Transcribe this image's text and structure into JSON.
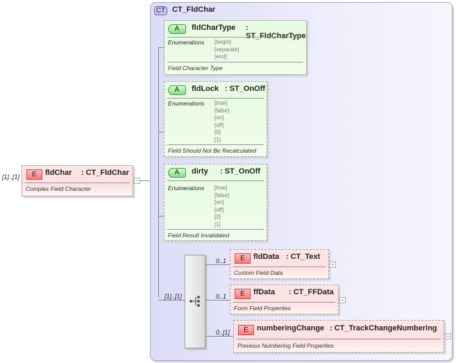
{
  "root": {
    "multiplicity": "[1]..[1]",
    "badge": "E",
    "name": "fldChar",
    "type": ": CT_FldChar",
    "description": "Complex Field Character",
    "collapse": "−"
  },
  "complex_type": {
    "badge": "CT",
    "name": "CT_FldChar"
  },
  "attributes": [
    {
      "badge": "A",
      "name": "fldCharType",
      "type": ": ST_FldCharType",
      "enum_label": "Enumerations",
      "enums": [
        "[begin]",
        "[separate]",
        "[end]"
      ],
      "description": "Field Character Type"
    },
    {
      "badge": "A",
      "name": "fldLock",
      "type": ": ST_OnOff",
      "enum_label": "Enumerations",
      "enums": [
        "[true]",
        "[false]",
        "[on]",
        "[off]",
        "[0]",
        "[1]"
      ],
      "description": "Field Should Not Be Recalculated"
    },
    {
      "badge": "A",
      "name": "dirty",
      "type": ": ST_OnOff",
      "enum_label": "Enumerations",
      "enums": [
        "[true]",
        "[false]",
        "[on]",
        "[off]",
        "[0]",
        "[1]"
      ],
      "description": "Field Result Invalidated"
    }
  ],
  "sequence": {
    "multiplicity": "[1]..[1]"
  },
  "children": [
    {
      "multiplicity": "0..1",
      "badge": "E",
      "name": "fldData",
      "type": ": CT_Text",
      "description": "Custom Field Data",
      "expand": "+"
    },
    {
      "multiplicity": "0..1",
      "badge": "E",
      "name": "ffData",
      "type": ": CT_FFData",
      "description": "Form Field Properties",
      "expand": "+"
    },
    {
      "multiplicity": "0..[1]",
      "badge": "E",
      "name": "numberingChange",
      "type": ": CT_TrackChangeNumbering",
      "description": "Previous Numbering Field Properties",
      "expand": "+"
    }
  ]
}
